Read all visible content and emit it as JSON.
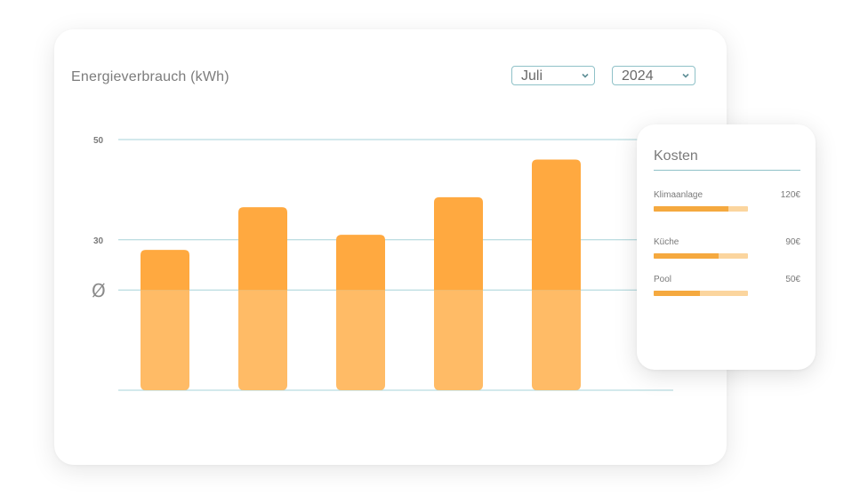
{
  "title": "Energieverbrauch (kWh)",
  "filters": {
    "month": "Juli",
    "year": "2024"
  },
  "chart_data": {
    "type": "bar",
    "categories": [],
    "values": [
      28,
      36.5,
      31,
      38.5,
      46
    ],
    "average": 20,
    "average_label": "Ø",
    "yticks": [
      50,
      30
    ],
    "ylim": [
      0,
      50
    ],
    "grid": true,
    "colors": {
      "above_average": "#ffa940",
      "below_average": "#ffbb66",
      "grid": "#a7d3d8"
    }
  },
  "costs": {
    "title": "Kosten",
    "items": [
      {
        "label": "Klimaanlage",
        "value": "120€",
        "fraction": 0.79
      },
      {
        "label": "Küche",
        "value": "90€",
        "fraction": 0.69
      },
      {
        "label": "Pool",
        "value": "50€",
        "fraction": 0.49
      }
    ],
    "colors": {
      "fill": "#f5a93f",
      "track": "#fbd59e"
    }
  }
}
